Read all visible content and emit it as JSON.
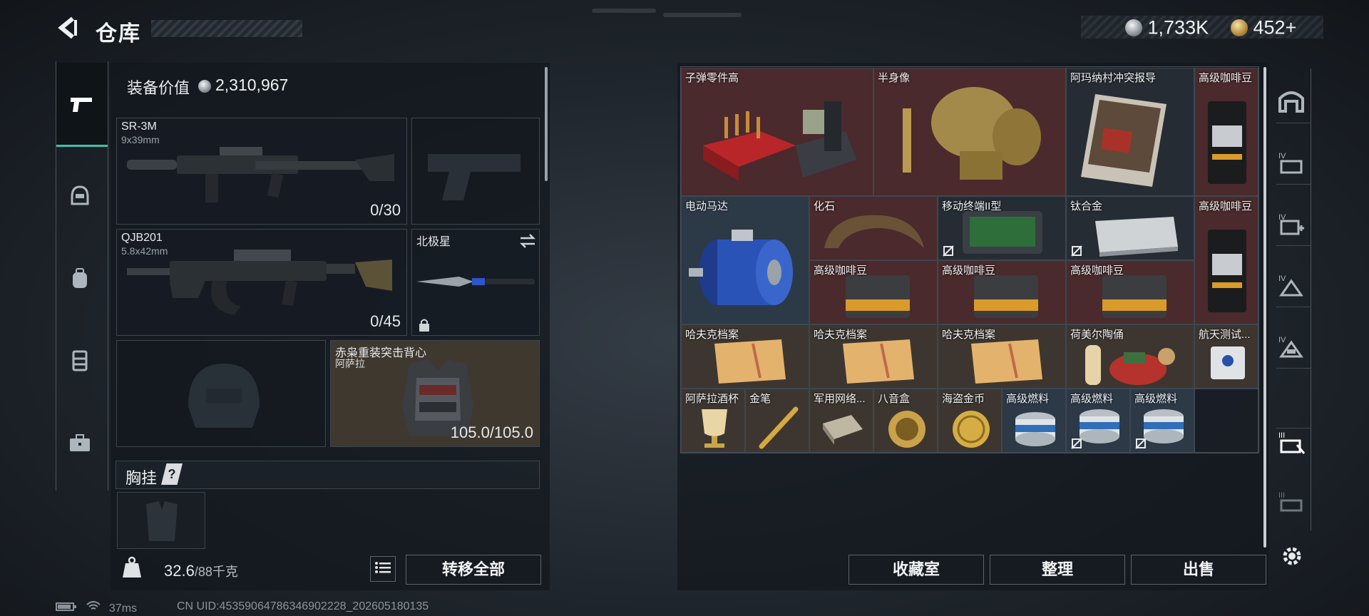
{
  "header": {
    "title": "仓库",
    "currency_silver": "1,733K",
    "currency_gold": "452",
    "gold_plus": "+"
  },
  "equipment": {
    "value_label": "装备价值",
    "value": "2,310,967",
    "primary": {
      "name": "SR-3M",
      "caliber": "9x39mm",
      "ammo": "0/30"
    },
    "secondary": {
      "name": "QJB201",
      "caliber": "5.8x42mm",
      "ammo": "0/45"
    },
    "melee": {
      "name": "北极星"
    },
    "armor": {
      "name": "赤枭重装突击背心",
      "sub": "阿萨拉",
      "durability": "105.0/105.0"
    },
    "chest_rig_label": "胸挂",
    "chest_rig_help": "?"
  },
  "footer": {
    "weight_value": "32.6",
    "weight_max": "/88千克",
    "transfer_all": "转移全部"
  },
  "storage": {
    "items": [
      {
        "id": "ammo-parts",
        "name": "子弹零件高"
      },
      {
        "id": "bust",
        "name": "半身像"
      },
      {
        "id": "magazine",
        "name": "阿玛纳村冲突报导"
      },
      {
        "id": "coffee1",
        "name": "高级咖啡豆"
      },
      {
        "id": "motor",
        "name": "电动马达"
      },
      {
        "id": "fossil",
        "name": "化石"
      },
      {
        "id": "terminal",
        "name": "移动终端II型"
      },
      {
        "id": "titanium",
        "name": "钛合金"
      },
      {
        "id": "coffee2",
        "name": "高级咖啡豆"
      },
      {
        "id": "coffee3",
        "name": "高级咖啡豆"
      },
      {
        "id": "coffee4",
        "name": "高级咖啡豆"
      },
      {
        "id": "coffee5",
        "name": "高级咖啡豆"
      },
      {
        "id": "file1",
        "name": "哈夫克档案"
      },
      {
        "id": "file2",
        "name": "哈夫克档案"
      },
      {
        "id": "file3",
        "name": "哈夫克档案"
      },
      {
        "id": "figurine",
        "name": "荷美尔陶俑"
      },
      {
        "id": "drive",
        "name": "航天测试..."
      },
      {
        "id": "cup",
        "name": "阿萨拉酒杯"
      },
      {
        "id": "pen",
        "name": "金笔"
      },
      {
        "id": "netcard",
        "name": "军用网络..."
      },
      {
        "id": "musicbox",
        "name": "八音盒"
      },
      {
        "id": "pirate-coin",
        "name": "海盗金币"
      },
      {
        "id": "fuel1",
        "name": "高级燃料"
      },
      {
        "id": "fuel2",
        "name": "高级燃料"
      },
      {
        "id": "fuel3",
        "name": "高级燃料"
      }
    ],
    "buttons": {
      "collection": "收藏室",
      "sort": "整理",
      "sell": "出售"
    }
  },
  "status": {
    "ping": "37ms",
    "uid": "CN UID:453590647863469022​28_202605180135"
  },
  "colors": {
    "accent": "#3fc1a9",
    "cell_red": "#4a2a2c",
    "cell_brown": "#3d3630",
    "cell_blue": "#2c3947"
  }
}
